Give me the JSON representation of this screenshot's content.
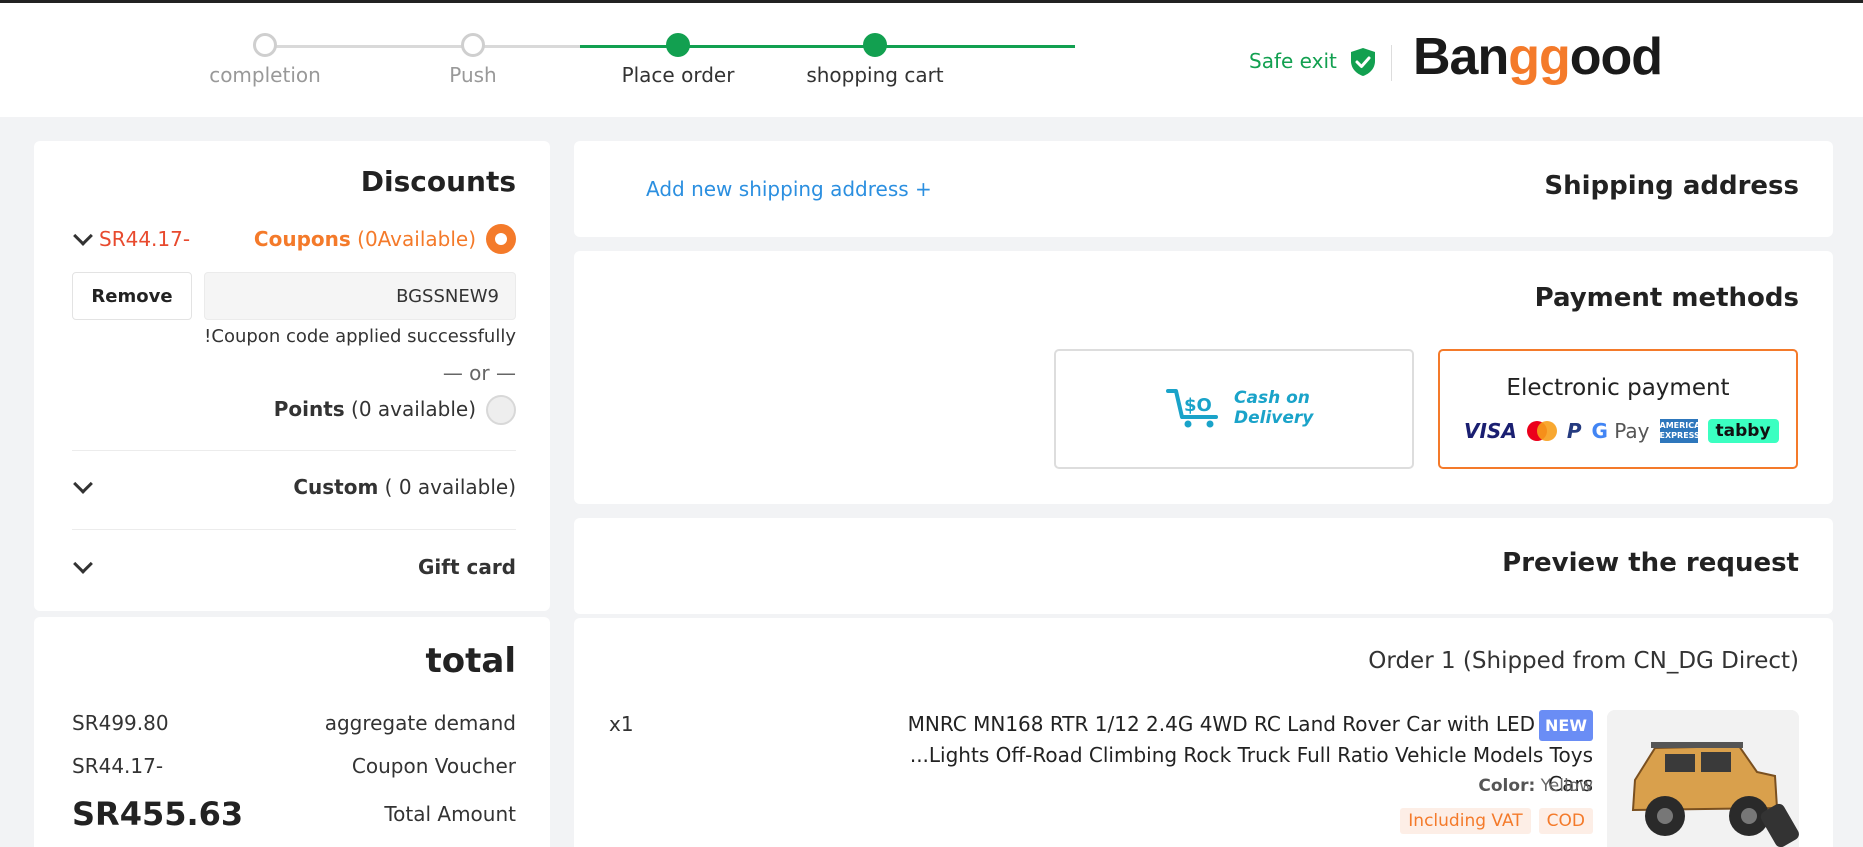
{
  "header": {
    "steps": [
      {
        "label": "completion",
        "state": "pending"
      },
      {
        "label": "Push",
        "state": "pending"
      },
      {
        "label": "Place order",
        "state": "done"
      },
      {
        "label": "shopping cart",
        "state": "done"
      }
    ],
    "safe_exit": "Safe exit",
    "logo_pre": "Ban",
    "logo_gg": "gg",
    "logo_post": "ood",
    "logo_alt": "Banggood"
  },
  "discounts": {
    "title": "Discounts",
    "coupon_amount": "SR44.17-",
    "coupons_label": "Coupons",
    "coupons_available": "(0Available)",
    "remove_label": "Remove",
    "coupon_code": "BGSSNEW9",
    "applied_msg": "!Coupon code applied successfully",
    "or_label": "— or —",
    "points_label": "Points",
    "points_available": "(0 available)",
    "custom_label": "Custom",
    "custom_available": "( 0 available)",
    "gift_label": "Gift card"
  },
  "total": {
    "title": "total",
    "rows": [
      {
        "value": "SR499.80",
        "label": "aggregate demand"
      },
      {
        "value": "SR44.17-",
        "label": "Coupon Voucher"
      },
      {
        "value": "SR455.63",
        "label": "Total Amount"
      }
    ]
  },
  "shipping": {
    "title": "Shipping address",
    "add_label": "Add new shipping address +"
  },
  "payment": {
    "title": "Payment methods",
    "cod_line1": "Cash on",
    "cod_line2": "Delivery",
    "epay_title": "Electronic payment",
    "brands": {
      "visa": "VISA",
      "paypal": "P",
      "gpay_g": "G",
      "gpay_text": "Pay",
      "amex": "AMERICAN EXPRESS",
      "tabby": "tabby"
    },
    "selected": "Electronic payment",
    "accent": "#f47a2a"
  },
  "preview": {
    "title": "Preview the request"
  },
  "order": {
    "title": "Order 1 (Shipped from CN_DG Direct)",
    "qty": "x1",
    "name_line1": "MNRC MN168 RTR 1/12 2.4G 4WD RC Land Rover Car with LED",
    "name_line2": "...Lights Off-Road Climbing Rock Truck Full Ratio Vehicle Models Toys Cars",
    "badge": "NEW",
    "color_label": "Color:",
    "color_value": "Yellow",
    "tag_vat": "Including VAT",
    "tag_cod": "COD"
  },
  "colors": {
    "green": "#12a050",
    "orange": "#f47a2a",
    "red": "#e84a2e",
    "link": "#2b8fe0"
  }
}
